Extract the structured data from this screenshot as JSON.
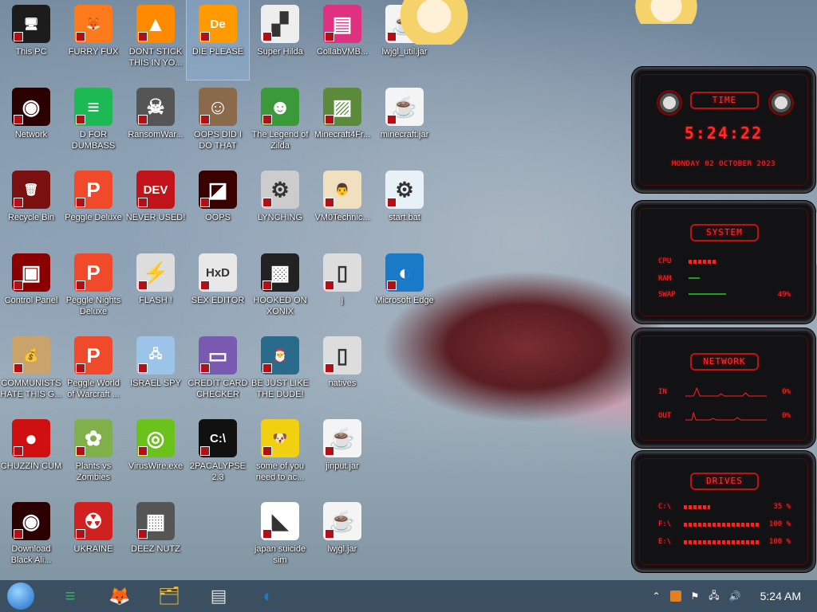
{
  "desktop": {
    "icons": [
      {
        "label": "This PC",
        "glyph": "🖥",
        "col": 0,
        "row": 0,
        "bg": "#1c1c1c"
      },
      {
        "label": "Network",
        "glyph": "◉",
        "col": 0,
        "row": 1,
        "bg": "#2a0000"
      },
      {
        "label": "Recycle Bin",
        "glyph": "🗑",
        "col": 0,
        "row": 2,
        "bg": "#7a1010"
      },
      {
        "label": "Control Panel",
        "glyph": "▣",
        "col": 0,
        "row": 3,
        "bg": "#8a0000"
      },
      {
        "label": "COMMUNISTS HATE THIS G...",
        "glyph": "💰",
        "col": 0,
        "row": 4,
        "bg": "#caa36a"
      },
      {
        "label": "CHUZZIN CUM",
        "glyph": "●",
        "col": 0,
        "row": 5,
        "bg": "#d01010"
      },
      {
        "label": "Download Black Ali...",
        "glyph": "◉",
        "col": 0,
        "row": 6,
        "bg": "#2a0000"
      },
      {
        "label": "FURRY FUX",
        "glyph": "🦊",
        "col": 1,
        "row": 0,
        "bg": "#ff7a1a"
      },
      {
        "label": "D FOR DUMBASS",
        "glyph": "≡",
        "col": 1,
        "row": 1,
        "bg": "#1db954"
      },
      {
        "label": "Peggle Deluxe",
        "glyph": "P",
        "col": 1,
        "row": 2,
        "bg": "#f04a2a"
      },
      {
        "label": "Peggle Nights Deluxe",
        "glyph": "P",
        "col": 1,
        "row": 3,
        "bg": "#f04a2a"
      },
      {
        "label": "Peggle World of Warcraft ...",
        "glyph": "P",
        "col": 1,
        "row": 4,
        "bg": "#f04a2a"
      },
      {
        "label": "Plants vs Zombies",
        "glyph": "✿",
        "col": 1,
        "row": 5,
        "bg": "#7fb04a"
      },
      {
        "label": "UKRAINE",
        "glyph": "☢",
        "col": 1,
        "row": 6,
        "bg": "#d02020"
      },
      {
        "label": "DONT STICK THIS IN YO...",
        "glyph": "▲",
        "col": 2,
        "row": 0,
        "bg": "#ff8a00"
      },
      {
        "label": "RansomWar...",
        "glyph": "☠",
        "col": 2,
        "row": 1,
        "bg": "#555"
      },
      {
        "label": "NEVER USED!",
        "glyph": "DEV",
        "col": 2,
        "row": 2,
        "bg": "#c0141a"
      },
      {
        "label": "FLASH !",
        "glyph": "⚡",
        "col": 2,
        "row": 3,
        "bg": "#ddd"
      },
      {
        "label": "ISRAEL SPY",
        "glyph": "🖧",
        "col": 2,
        "row": 4,
        "bg": "#9cc4e8"
      },
      {
        "label": "VirusWire.exe",
        "glyph": "◎",
        "col": 2,
        "row": 5,
        "bg": "#6ac21a"
      },
      {
        "label": "DEEZ NUTZ",
        "glyph": "▦",
        "col": 2,
        "row": 6,
        "bg": "#555"
      },
      {
        "label": "DIE PLEASE",
        "glyph": "De",
        "col": 3,
        "row": 0,
        "bg": "#ff9a00",
        "selected": true
      },
      {
        "label": "OOPS DID I DO THAT",
        "glyph": "☺",
        "col": 3,
        "row": 1,
        "bg": "#8a6a4a"
      },
      {
        "label": "OOPS",
        "glyph": "◪",
        "col": 3,
        "row": 2,
        "bg": "#3a0000"
      },
      {
        "label": "SEX EDITOR",
        "glyph": "HxD",
        "col": 3,
        "row": 3,
        "bg": "#e8e8e8"
      },
      {
        "label": "CREDIT CARD CHECKER",
        "glyph": "▭",
        "col": 3,
        "row": 4,
        "bg": "#7a5ab0"
      },
      {
        "label": "2PACALYPSE 2.3",
        "glyph": "C:\\",
        "col": 3,
        "row": 5,
        "bg": "#111"
      },
      {
        "label": "Super Hilda",
        "glyph": "▞",
        "col": 4,
        "row": 0,
        "bg": "#eee"
      },
      {
        "label": "The Legend of Zilda",
        "glyph": "☻",
        "col": 4,
        "row": 1,
        "bg": "#3a9a3a"
      },
      {
        "label": "LYNCHING",
        "glyph": "⚙",
        "col": 4,
        "row": 2,
        "bg": "#ccc"
      },
      {
        "label": "HOOKED ON XONIX",
        "glyph": "▩",
        "col": 4,
        "row": 3,
        "bg": "#222"
      },
      {
        "label": "BE JUST LIKE THE DUDE!",
        "glyph": "🎅",
        "col": 4,
        "row": 4,
        "bg": "#2a6a8a"
      },
      {
        "label": "some of you need to ac...",
        "glyph": "🐶",
        "col": 4,
        "row": 5,
        "bg": "#f0d010"
      },
      {
        "label": "japan suicide sim",
        "glyph": "◣",
        "col": 4,
        "row": 6,
        "bg": "#fff"
      },
      {
        "label": "CollabVMB...",
        "glyph": "▤",
        "col": 5,
        "row": 0,
        "bg": "#e03080"
      },
      {
        "label": "Minecraft4Fr...",
        "glyph": "▨",
        "col": 5,
        "row": 1,
        "bg": "#5a8a3a"
      },
      {
        "label": "VM0Technic...",
        "glyph": "👨",
        "col": 5,
        "row": 2,
        "bg": "#f0e0c0"
      },
      {
        "label": "j",
        "glyph": "▯",
        "col": 5,
        "row": 3,
        "bg": "#ddd"
      },
      {
        "label": "natives",
        "glyph": "▯",
        "col": 5,
        "row": 4,
        "bg": "#ddd"
      },
      {
        "label": "jinput.jar",
        "glyph": "☕",
        "col": 5,
        "row": 5,
        "bg": "#f4f4f4"
      },
      {
        "label": "lwjgl.jar",
        "glyph": "☕",
        "col": 5,
        "row": 6,
        "bg": "#f4f4f4"
      },
      {
        "label": "lwjgl_util.jar",
        "glyph": "☕",
        "col": 6,
        "row": 0,
        "bg": "#f4f4f4"
      },
      {
        "label": "minecraft.jar",
        "glyph": "☕",
        "col": 6,
        "row": 1,
        "bg": "#f4f4f4"
      },
      {
        "label": "start.bat",
        "glyph": "⚙",
        "col": 6,
        "row": 2,
        "bg": "#e8f0f8"
      },
      {
        "label": "Microsoft Edge",
        "glyph": "◐",
        "col": 6,
        "row": 3,
        "bg": "#1a7ac8"
      }
    ]
  },
  "widgets": {
    "time": {
      "title": "TIME",
      "clock": "5:24:22",
      "date": "MONDAY 02 OCTOBER 2023"
    },
    "system": {
      "title": "SYSTEM",
      "cpu_label": "CPU",
      "ram_label": "RAM",
      "swap_label": "SWAP",
      "swap_value": "49%",
      "cpu": 0.35,
      "ram": 0.15,
      "swap": 0.49
    },
    "network": {
      "title": "NETWORK",
      "in_label": "IN",
      "in_value": "0%",
      "out_label": "OUT",
      "out_value": "0%"
    },
    "drives": {
      "title": "DRIVES",
      "drives": [
        {
          "label": "C:\\",
          "value": "35 %",
          "fill": 0.35
        },
        {
          "label": "F:\\",
          "value": "100 %",
          "fill": 1.0
        },
        {
          "label": "E:\\",
          "value": "100 %",
          "fill": 1.0
        }
      ]
    }
  },
  "taskbar": {
    "apps": [
      {
        "name": "start-button",
        "glyph": "●",
        "color": "#3a9af0"
      },
      {
        "name": "spotify",
        "glyph": "≡",
        "color": "#1db954"
      },
      {
        "name": "firefox",
        "glyph": "🦊",
        "color": "#ff7a1a"
      },
      {
        "name": "file-explorer",
        "glyph": "🗂",
        "color": "#f0c040"
      },
      {
        "name": "window-app",
        "glyph": "▤",
        "color": "#ddd"
      },
      {
        "name": "edge",
        "glyph": "◐",
        "color": "#1a7ac8"
      }
    ],
    "clock": "5:24 AM"
  }
}
